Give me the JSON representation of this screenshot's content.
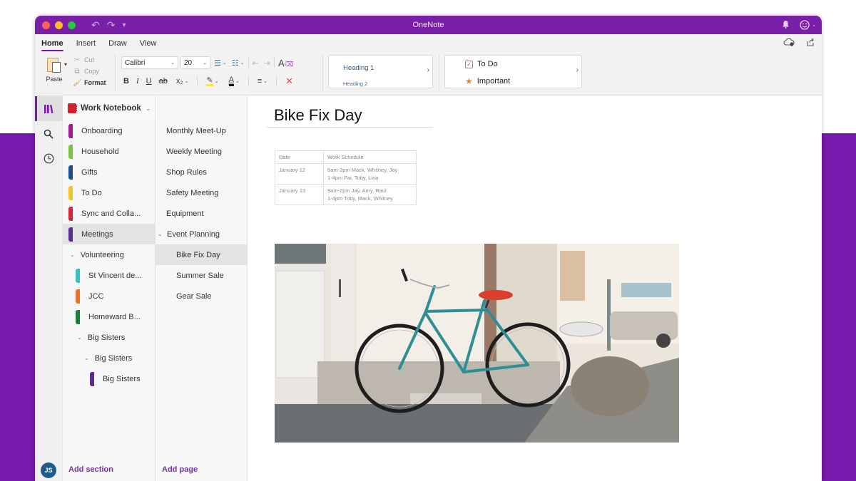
{
  "window": {
    "title": "OneNote"
  },
  "colors": {
    "brand": "#7719aa",
    "title_bar": "#7a1fa8",
    "link": "#7a2fa8",
    "avatar": "#1f5c8c",
    "notebook": "#d0202e"
  },
  "quick_access": {
    "undo_icon": "↶",
    "redo_icon": "↷",
    "customize_icon": "▾"
  },
  "title_bar_right": {
    "notifications_icon": "bell",
    "account_icon": "smiley"
  },
  "ribbon": {
    "tabs": [
      {
        "label": "Home",
        "active": true
      },
      {
        "label": "Insert",
        "active": false
      },
      {
        "label": "Draw",
        "active": false
      },
      {
        "label": "View",
        "active": false
      }
    ],
    "clipboard": {
      "paste": "Paste",
      "cut": "Cut",
      "copy": "Copy",
      "format": "Format"
    },
    "font": {
      "name": "Calibri",
      "size": "20"
    },
    "format_buttons": {
      "bold": "B",
      "italic": "I",
      "underline": "U",
      "strikethrough": "ab",
      "subscript": "x₂"
    },
    "styles": {
      "heading1": "Heading 1",
      "heading2": "Heading 2"
    },
    "tags": {
      "todo": "To Do",
      "important": "Important"
    }
  },
  "notebook": {
    "name": "Work Notebook"
  },
  "sections": [
    {
      "label": "Onboarding",
      "color": "#a11d8f",
      "type": "section"
    },
    {
      "label": "Household",
      "color": "#7ac143",
      "type": "section"
    },
    {
      "label": "Gifts",
      "color": "#1b4f8c",
      "type": "section"
    },
    {
      "label": "To Do",
      "color": "#f2c42c",
      "type": "section"
    },
    {
      "label": "Sync and Colla...",
      "color": "#d02a3a",
      "type": "section"
    },
    {
      "label": "Meetings",
      "color": "#5c2d91",
      "type": "section",
      "selected": true
    },
    {
      "label": "Volunteering",
      "type": "group"
    },
    {
      "label": "St Vincent de...",
      "color": "#3bbfbf",
      "type": "section",
      "indent": 1
    },
    {
      "label": "JCC",
      "color": "#e8742a",
      "type": "section",
      "indent": 1
    },
    {
      "label": "Homeward B...",
      "color": "#1e7d3a",
      "type": "section",
      "indent": 1
    },
    {
      "label": "Big Sisters",
      "type": "group",
      "indent": 1
    },
    {
      "label": "Big Sisters",
      "type": "group",
      "indent": 2
    },
    {
      "label": "Big Sisters",
      "color": "#5c2d91",
      "type": "section",
      "indent": 3
    }
  ],
  "pages": [
    {
      "label": "Monthly Meet-Up"
    },
    {
      "label": "Weekly Meeting"
    },
    {
      "label": "Shop Rules"
    },
    {
      "label": "Safety Meeting"
    },
    {
      "label": "Equipment"
    },
    {
      "label": "Event Planning",
      "expanded": true
    },
    {
      "label": "Bike Fix Day",
      "sub": true,
      "selected": true
    },
    {
      "label": "Summer Sale",
      "sub": true
    },
    {
      "label": "Gear Sale",
      "sub": true
    }
  ],
  "footer": {
    "add_section": "Add section",
    "add_page": "Add page",
    "avatar_initials": "JS"
  },
  "page": {
    "title": "Bike Fix Day",
    "table": {
      "headers": [
        "Date",
        "Work Schedule"
      ],
      "rows": [
        {
          "date": "January 12",
          "lines": [
            "9am-2pm Mack, Whitney, Jay",
            "1-4pm Fai, Toby, Lina"
          ]
        },
        {
          "date": "January 13",
          "lines": [
            "9am-2pm Jay, Amy, Raul",
            "1-4pm Toby, Mack, Whitney"
          ]
        }
      ]
    },
    "image": {
      "description": "teal bicycle leaning against a white wall on a cobblestone street"
    }
  }
}
